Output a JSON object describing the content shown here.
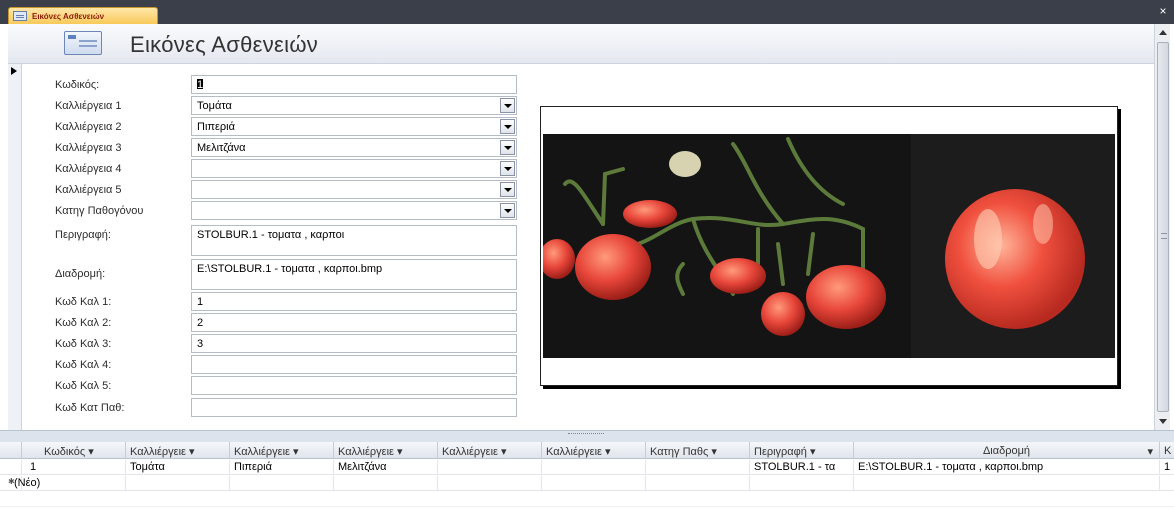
{
  "window": {
    "tab_label": "Εικόνες Ασθενειών",
    "close_glyph": "×"
  },
  "header": {
    "title": "Εικόνες Ασθενειών"
  },
  "form": {
    "fields": [
      {
        "label": "Κωδικός:",
        "value": "1"
      },
      {
        "label": "Καλλιέργεια 1",
        "value": "Τομάτα"
      },
      {
        "label": "Καλλιέργεια 2",
        "value": "Πιπεριά"
      },
      {
        "label": "Καλλιέργεια 3",
        "value": "Μελιτζάνα"
      },
      {
        "label": "Καλλιέργεια 4",
        "value": ""
      },
      {
        "label": "Καλλιέργεια 5",
        "value": ""
      },
      {
        "label": "Κατηγ Παθογόνου",
        "value": ""
      },
      {
        "label": "Περιγραφή:",
        "value": "STOLBUR.1 - τοματα , καρποι"
      },
      {
        "label": "Διαδρομή:",
        "value": "E:\\STOLBUR.1 - τοματα , καρποι.bmp"
      },
      {
        "label": "Κωδ Καλ 1:",
        "value": "1"
      },
      {
        "label": "Κωδ Καλ 2:",
        "value": "2"
      },
      {
        "label": "Κωδ Καλ 3:",
        "value": "3"
      },
      {
        "label": "Κωδ Καλ 4:",
        "value": ""
      },
      {
        "label": "Κωδ Καλ 5:",
        "value": ""
      },
      {
        "label": "Κωδ Κατ Παθ:",
        "value": ""
      }
    ]
  },
  "datasheet": {
    "headers": [
      "Κωδικός",
      "Καλλιέργειε",
      "Καλλιέργειε",
      "Καλλιέργειε",
      "Καλλιέργειε",
      "Καλλιέργειε",
      "Κατηγ Παθς",
      "Περιγραφή",
      "Διαδρομή",
      "K"
    ],
    "dropdown_glyph": "▾",
    "rows": [
      [
        "1",
        "Τομάτα",
        "Πιπεριά",
        "Μελιτζάνα",
        "",
        "",
        "",
        "STOLBUR.1 - τα",
        "E:\\STOLBUR.1 - τοματα , καρποι.bmp",
        "1"
      ]
    ],
    "new_row_label": "(Νέο)",
    "new_row_marker": "✱"
  }
}
